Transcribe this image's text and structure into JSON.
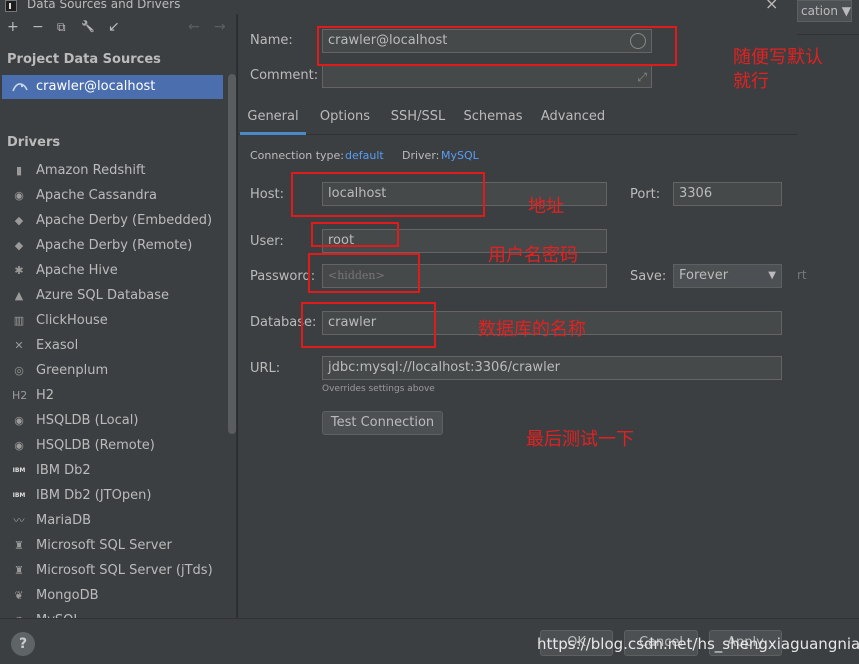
{
  "window": {
    "title": "Data Sources and Drivers",
    "close_glyph": "×"
  },
  "background_combo": "cation ▼",
  "background_partial": "rt",
  "toolbar": {
    "add": "+",
    "remove": "−",
    "duplicate": "⧉",
    "wrench": "🔧",
    "import": "↙",
    "back": "←",
    "forward": "→"
  },
  "sidebar": {
    "project_heading": "Project Data Sources",
    "data_source": "crawler@localhost",
    "drivers_heading": "Drivers",
    "drivers": [
      {
        "label": "Amazon Redshift",
        "icon": "▮"
      },
      {
        "label": "Apache Cassandra",
        "icon": "◉"
      },
      {
        "label": "Apache Derby (Embedded)",
        "icon": "◆"
      },
      {
        "label": "Apache Derby (Remote)",
        "icon": "◆"
      },
      {
        "label": "Apache Hive",
        "icon": "✱"
      },
      {
        "label": "Azure SQL Database",
        "icon": "▲"
      },
      {
        "label": "ClickHouse",
        "icon": "▥"
      },
      {
        "label": "Exasol",
        "icon": "✕"
      },
      {
        "label": "Greenplum",
        "icon": "◎"
      },
      {
        "label": "H2",
        "icon": "H2"
      },
      {
        "label": "HSQLDB (Local)",
        "icon": "◉"
      },
      {
        "label": "HSQLDB (Remote)",
        "icon": "◉"
      },
      {
        "label": "IBM Db2",
        "icon": "IBM"
      },
      {
        "label": "IBM Db2 (JTOpen)",
        "icon": "IBM"
      },
      {
        "label": "MariaDB",
        "icon": "〰"
      },
      {
        "label": "Microsoft SQL Server",
        "icon": "♜"
      },
      {
        "label": "Microsoft SQL Server (jTds)",
        "icon": "♜"
      },
      {
        "label": "MongoDB",
        "icon": "❦"
      },
      {
        "label": "MySQL",
        "icon": "◔"
      }
    ]
  },
  "form": {
    "name_label": "Name:",
    "name_value": "crawler@localhost",
    "comment_label": "Comment:",
    "comment_value": "",
    "tabs": [
      "General",
      "Options",
      "SSH/SSL",
      "Schemas",
      "Advanced"
    ],
    "connection_type_label": "Connection type:",
    "connection_type_value": "default",
    "driver_label": "Driver:",
    "driver_value": "MySQL",
    "host_label": "Host:",
    "host_value": "localhost",
    "port_label": "Port:",
    "port_value": "3306",
    "user_label": "User:",
    "user_value": "root",
    "password_label": "Password:",
    "password_value": "<hidden>",
    "save_label": "Save:",
    "save_value": "Forever",
    "database_label": "Database:",
    "database_value": "crawler",
    "url_label": "URL:",
    "url_value": "jdbc:mysql://localhost:3306/crawler",
    "url_hint": "Overrides settings above",
    "test_button": "Test Connection"
  },
  "footer": {
    "help": "?",
    "ok": "OK",
    "cancel": "Cancel",
    "apply": "Apply",
    "watermark": "https://blog.csdn.net/hs_shengxiaguangnian"
  },
  "annotations": {
    "name": "随便写默认就行",
    "host": "地址",
    "credentials": "用户名密码",
    "database": "数据库的名称",
    "test": "最后测试一下"
  },
  "colors": {
    "accent": "#4b6eaf",
    "link": "#589df6",
    "annotation": "#e01b1b"
  }
}
